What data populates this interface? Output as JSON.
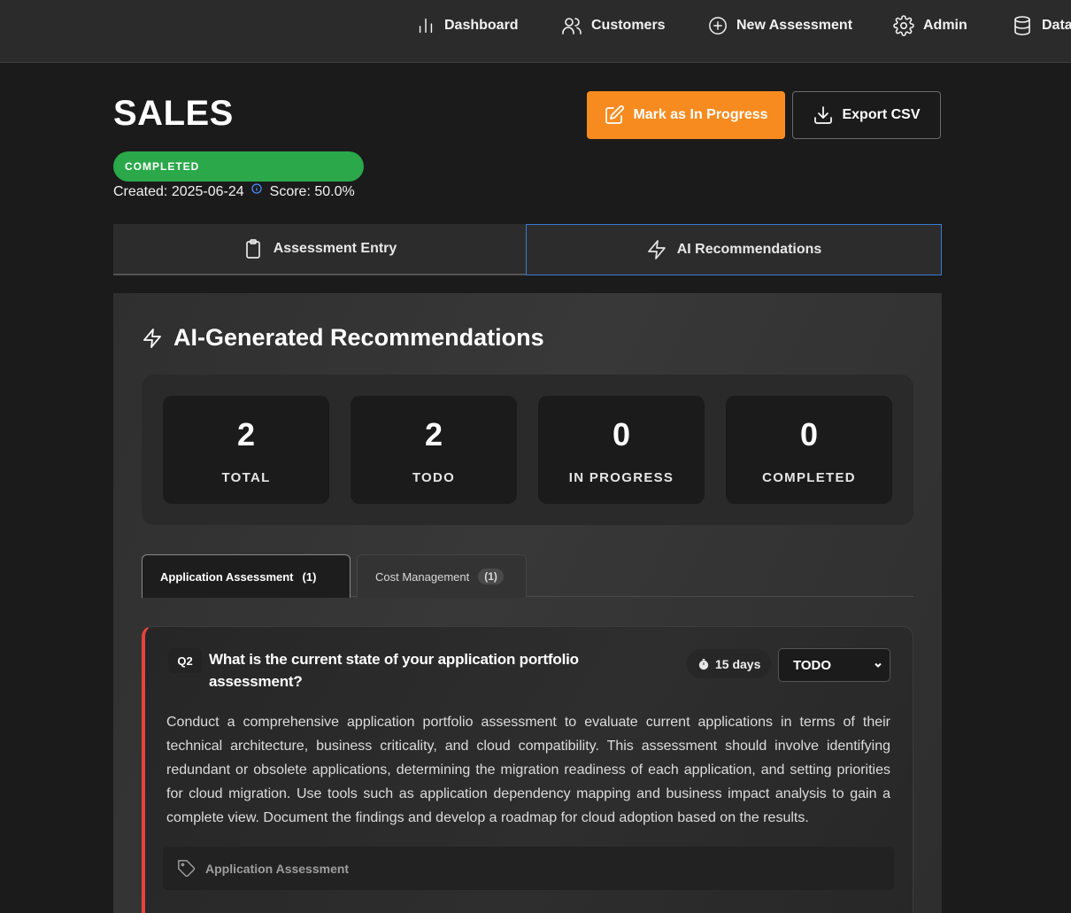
{
  "nav": {
    "dashboard": "Dashboard",
    "customers": "Customers",
    "new_assessment": "New Assessment",
    "admin": "Admin",
    "data": "Data"
  },
  "header": {
    "title": "SALES",
    "status": "COMPLETED",
    "created": "Created: 2025-06-24",
    "score": "Score: 50.0%",
    "mark_in_progress": "Mark as In Progress",
    "export_csv": "Export CSV"
  },
  "tabs": {
    "assessment_entry": "Assessment Entry",
    "ai_recommendations": "AI Recommendations"
  },
  "panel": {
    "title": "AI-Generated Recommendations",
    "stats": [
      {
        "value": "2",
        "label": "TOTAL"
      },
      {
        "value": "2",
        "label": "TODO"
      },
      {
        "value": "0",
        "label": "IN PROGRESS"
      },
      {
        "value": "0",
        "label": "COMPLETED"
      }
    ],
    "categories": [
      {
        "label": "Application Assessment",
        "count": "(1)"
      },
      {
        "label": "Cost Management",
        "count": "(1)"
      }
    ]
  },
  "recommendation": {
    "id": "Q2",
    "question": "What is the current state of your application portfolio assessment?",
    "duration": "15 days",
    "status": "TODO",
    "text": "Conduct a comprehensive application portfolio assessment to evaluate current applications in terms of their technical architecture, business criticality, and cloud compatibility. This assessment should involve identifying redundant or obsolete applications, determining the migration readiness of each application, and setting priorities for cloud migration. Use tools such as application dependency mapping and business impact analysis to gain a complete view. Document the findings and develop a roadmap for cloud adoption based on the results.",
    "tag": "Application Assessment"
  },
  "colors": {
    "accent_orange": "#f78b1f",
    "status_green": "#2aa84a",
    "active_tab_border": "#3a7bd5",
    "card_accent_red": "#e8423a"
  }
}
